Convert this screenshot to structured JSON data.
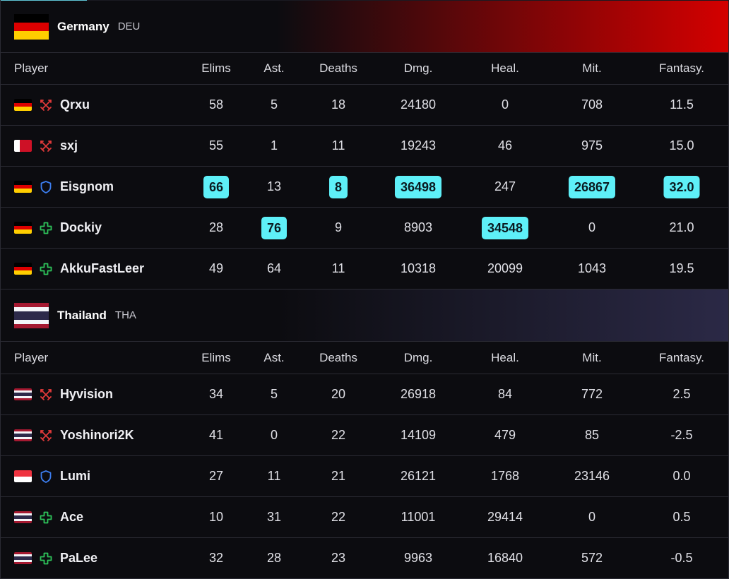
{
  "colors": {
    "highlight": "#5ef0f8",
    "damage_role": "#e03a3a",
    "tank_role": "#3c7ef0",
    "support_role": "#2ec45a",
    "germany_gradient_end": "#d40000",
    "thailand_gradient_end": "#2b2946"
  },
  "columns": [
    "Player",
    "Elims",
    "Ast.",
    "Deaths",
    "Dmg.",
    "Heal.",
    "Mit.",
    "Fantasy."
  ],
  "teams": [
    {
      "name": "Germany",
      "code": "DEU",
      "flag": "germany",
      "players": [
        {
          "flag": "germany",
          "role": "damage",
          "name": "Qrxu",
          "elims": "58",
          "ast": "5",
          "deaths": "18",
          "dmg": "24180",
          "heal": "0",
          "mit": "708",
          "fantasy": "11.5",
          "hl": []
        },
        {
          "flag": "bahrain",
          "role": "damage",
          "name": "sxj",
          "elims": "55",
          "ast": "1",
          "deaths": "11",
          "dmg": "19243",
          "heal": "46",
          "mit": "975",
          "fantasy": "15.0",
          "hl": []
        },
        {
          "flag": "germany",
          "role": "tank",
          "name": "Eisgnom",
          "elims": "66",
          "ast": "13",
          "deaths": "8",
          "dmg": "36498",
          "heal": "247",
          "mit": "26867",
          "fantasy": "32.0",
          "hl": [
            "elims",
            "deaths",
            "dmg",
            "mit",
            "fantasy"
          ]
        },
        {
          "flag": "germany",
          "role": "support",
          "name": "Dockiy",
          "elims": "28",
          "ast": "76",
          "deaths": "9",
          "dmg": "8903",
          "heal": "34548",
          "mit": "0",
          "fantasy": "21.0",
          "hl": [
            "ast",
            "heal"
          ]
        },
        {
          "flag": "germany",
          "role": "support",
          "name": "AkkuFastLeer",
          "elims": "49",
          "ast": "64",
          "deaths": "11",
          "dmg": "10318",
          "heal": "20099",
          "mit": "1043",
          "fantasy": "19.5",
          "hl": []
        }
      ]
    },
    {
      "name": "Thailand",
      "code": "THA",
      "flag": "thailand",
      "players": [
        {
          "flag": "thailand",
          "role": "damage",
          "name": "Hyvision",
          "elims": "34",
          "ast": "5",
          "deaths": "20",
          "dmg": "26918",
          "heal": "84",
          "mit": "772",
          "fantasy": "2.5",
          "hl": []
        },
        {
          "flag": "thailand",
          "role": "damage",
          "name": "Yoshinori2K",
          "elims": "41",
          "ast": "0",
          "deaths": "22",
          "dmg": "14109",
          "heal": "479",
          "mit": "85",
          "fantasy": "-2.5",
          "hl": []
        },
        {
          "flag": "singapore",
          "role": "tank",
          "name": "Lumi",
          "elims": "27",
          "ast": "11",
          "deaths": "21",
          "dmg": "26121",
          "heal": "1768",
          "mit": "23146",
          "fantasy": "0.0",
          "hl": []
        },
        {
          "flag": "thailand",
          "role": "support",
          "name": "Ace",
          "elims": "10",
          "ast": "31",
          "deaths": "22",
          "dmg": "11001",
          "heal": "29414",
          "mit": "0",
          "fantasy": "0.5",
          "hl": []
        },
        {
          "flag": "thailand",
          "role": "support",
          "name": "PaLee",
          "elims": "32",
          "ast": "28",
          "deaths": "23",
          "dmg": "9963",
          "heal": "16840",
          "mit": "572",
          "fantasy": "-0.5",
          "hl": []
        }
      ]
    }
  ]
}
